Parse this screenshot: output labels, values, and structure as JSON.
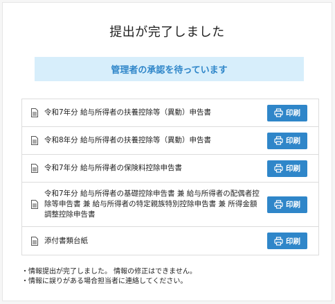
{
  "page": {
    "title": "提出が完了しました",
    "status_banner": "管理者の承認を待っています"
  },
  "documents": [
    {
      "label": "令和7年分 給与所得者の扶養控除等（異動）申告書",
      "button": "印刷"
    },
    {
      "label": "令和8年分 給与所得者の扶養控除等（異動）申告書",
      "button": "印刷"
    },
    {
      "label": "令和7年分 給与所得者の保険料控除申告書",
      "button": "印刷"
    },
    {
      "label": "令和7年分 給与所得者の基礎控除申告書 兼 給与所得者の配偶者控除等申告書 兼 給与所得者の特定親族特別控除申告書 兼 所得金額調整控除申告書",
      "button": "印刷"
    },
    {
      "label": "添付書類台紙",
      "button": "印刷"
    }
  ],
  "notes": [
    "・情報提出が完了しました。 情報の修正はできません。",
    "・情報に誤りがある場合担当者に連絡してください。"
  ],
  "icons": {
    "document": "document-icon",
    "print": "printer-icon"
  },
  "colors": {
    "accent": "#2f86c9",
    "banner_bg": "#d7eefb",
    "banner_text": "#2f86c9"
  }
}
